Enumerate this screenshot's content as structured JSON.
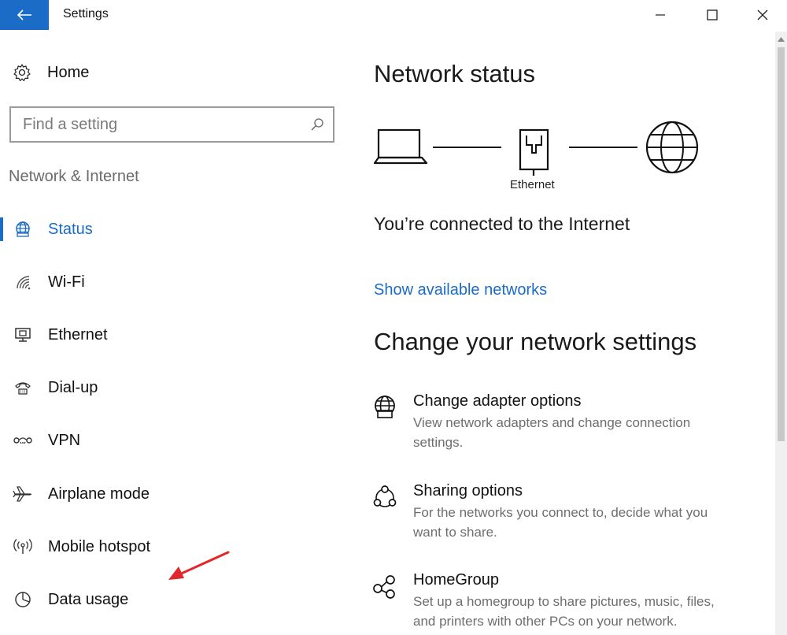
{
  "window": {
    "title": "Settings"
  },
  "sidebar": {
    "home_label": "Home",
    "search_placeholder": "Find a setting",
    "section_title": "Network & Internet",
    "items": [
      {
        "label": "Status",
        "icon": "status-globe-icon",
        "active": true
      },
      {
        "label": "Wi-Fi",
        "icon": "wifi-icon",
        "active": false
      },
      {
        "label": "Ethernet",
        "icon": "ethernet-icon",
        "active": false
      },
      {
        "label": "Dial-up",
        "icon": "dialup-icon",
        "active": false
      },
      {
        "label": "VPN",
        "icon": "vpn-icon",
        "active": false
      },
      {
        "label": "Airplane mode",
        "icon": "airplane-icon",
        "active": false
      },
      {
        "label": "Mobile hotspot",
        "icon": "hotspot-icon",
        "active": false
      },
      {
        "label": "Data usage",
        "icon": "data-usage-icon",
        "active": false
      }
    ]
  },
  "main": {
    "network_status_title": "Network status",
    "connection_label": "Ethernet",
    "connected_text": "You’re connected to the Internet",
    "show_networks_link": "Show available networks",
    "change_settings_title": "Change your network settings",
    "options": [
      {
        "title": "Change adapter options",
        "description": "View network adapters and change connection settings.",
        "icon": "adapter-globe-icon"
      },
      {
        "title": "Sharing options",
        "description": "For the networks you connect to, decide what you want to share.",
        "icon": "sharing-icon"
      },
      {
        "title": "HomeGroup",
        "description": "Set up a homegroup to share pictures, music, files, and printers with other PCs on your network.",
        "icon": "homegroup-icon"
      }
    ]
  },
  "colors": {
    "accent": "#1a6cc7",
    "annotation_arrow": "#e0282c",
    "secondary_text": "#6e6e6e"
  }
}
